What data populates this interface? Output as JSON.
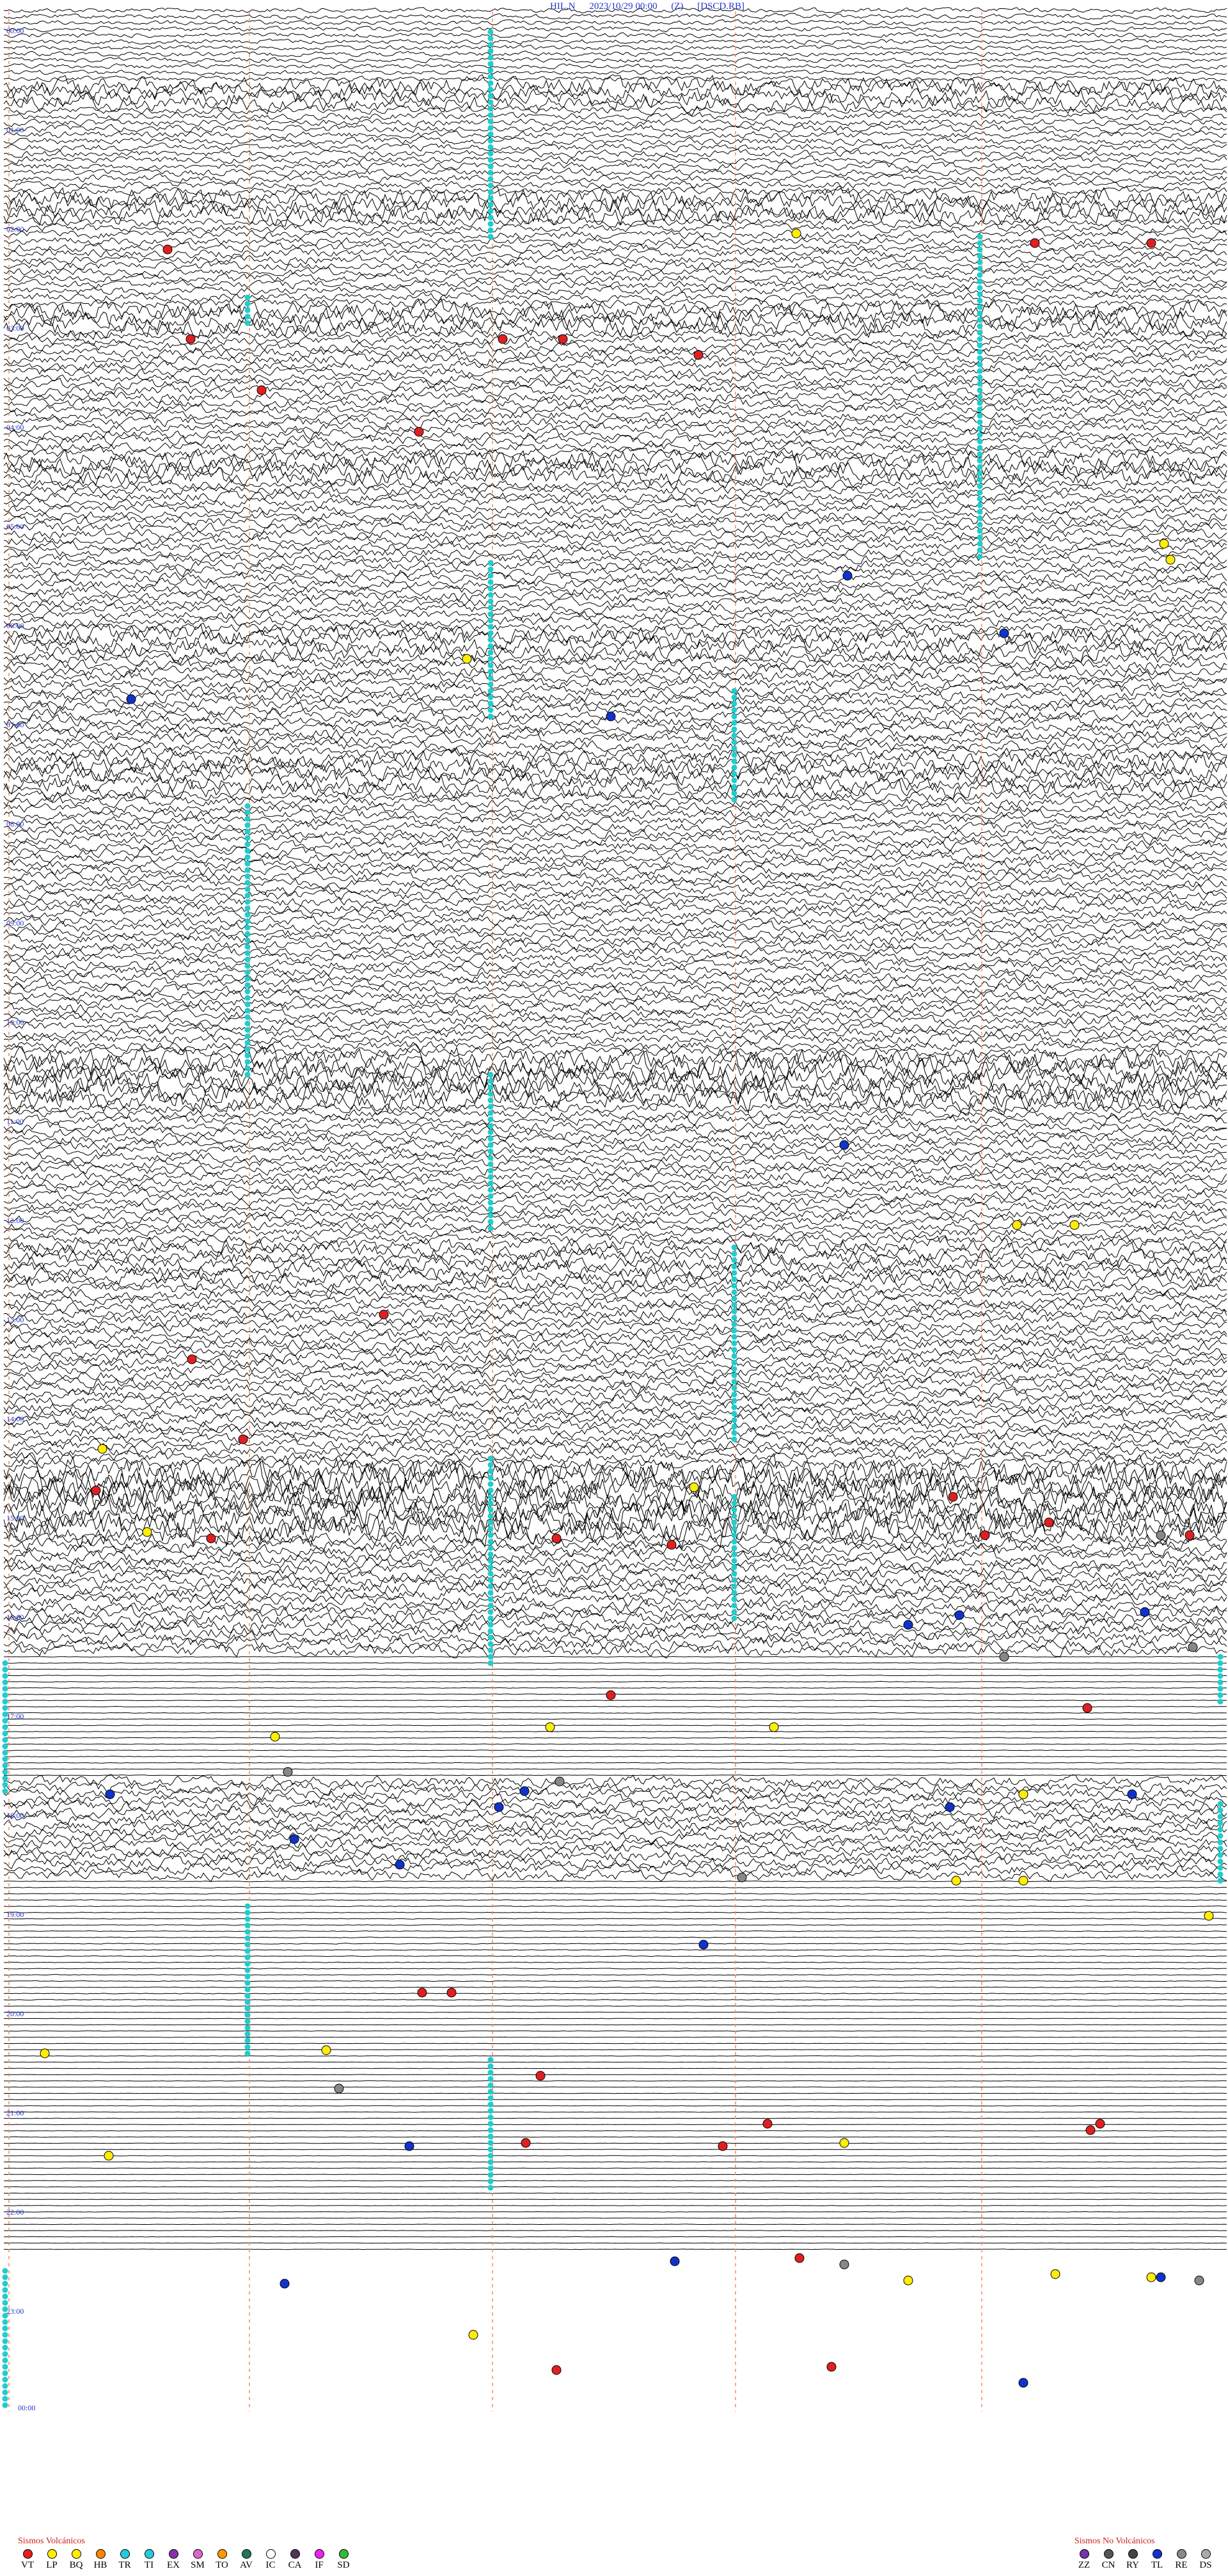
{
  "header": {
    "station": "HIL.N",
    "date": "2023/10/29 00:00",
    "component": "(Z)",
    "period": "[DSCD.RB]"
  },
  "time_labels": [
    "00:00",
    "01:00",
    "02:00",
    "03:00",
    "04:00",
    "05:00",
    "06:00",
    "07:00",
    "08:00",
    "09:00",
    "10:00",
    "11:00",
    "12:00",
    "13:00",
    "14:00",
    "15:00",
    "16:00",
    "17:00",
    "18:00",
    "19:00",
    "20:00",
    "21:00",
    "22:00",
    "23:00",
    "00:00"
  ],
  "legend_volcanic": {
    "title": "Sismos Volcánicos",
    "items": [
      {
        "code": "VT",
        "color": "#e02020"
      },
      {
        "code": "LP",
        "color": "#ffee00"
      },
      {
        "code": "BQ",
        "color": "#ffee00"
      },
      {
        "code": "HB",
        "color": "#ff8800"
      },
      {
        "code": "TR",
        "color": "#22ccdd"
      },
      {
        "code": "TI",
        "color": "#22ccdd"
      },
      {
        "code": "EX",
        "color": "#8833aa"
      },
      {
        "code": "SM",
        "color": "#dd66cc"
      },
      {
        "code": "TO",
        "color": "#ff9900"
      },
      {
        "code": "AV",
        "color": "#227755"
      },
      {
        "code": "IC",
        "color": "#ffffff"
      },
      {
        "code": "CA",
        "color": "#553355"
      },
      {
        "code": "IF",
        "color": "#ee22ee"
      },
      {
        "code": "SD",
        "color": "#33bb33"
      }
    ]
  },
  "legend_nonvolcanic": {
    "title": "Sismos No Volcánicos",
    "items": [
      {
        "code": "ZZ",
        "color": "#7733aa"
      },
      {
        "code": "CN",
        "color": "#555555"
      },
      {
        "code": "RY",
        "color": "#444444"
      },
      {
        "code": "TL",
        "color": "#1133cc"
      },
      {
        "code": "RE",
        "color": "#888888"
      },
      {
        "code": "DS",
        "color": "#aaaaaa"
      }
    ]
  },
  "colors": {
    "trace": "#000000",
    "label": "#2233cc",
    "hour_marker": "#ff8855",
    "tremor_marker": "#22cccc",
    "vt": "#e02020",
    "lp": "#ffee00",
    "tl": "#1133cc",
    "re": "#888888"
  }
}
